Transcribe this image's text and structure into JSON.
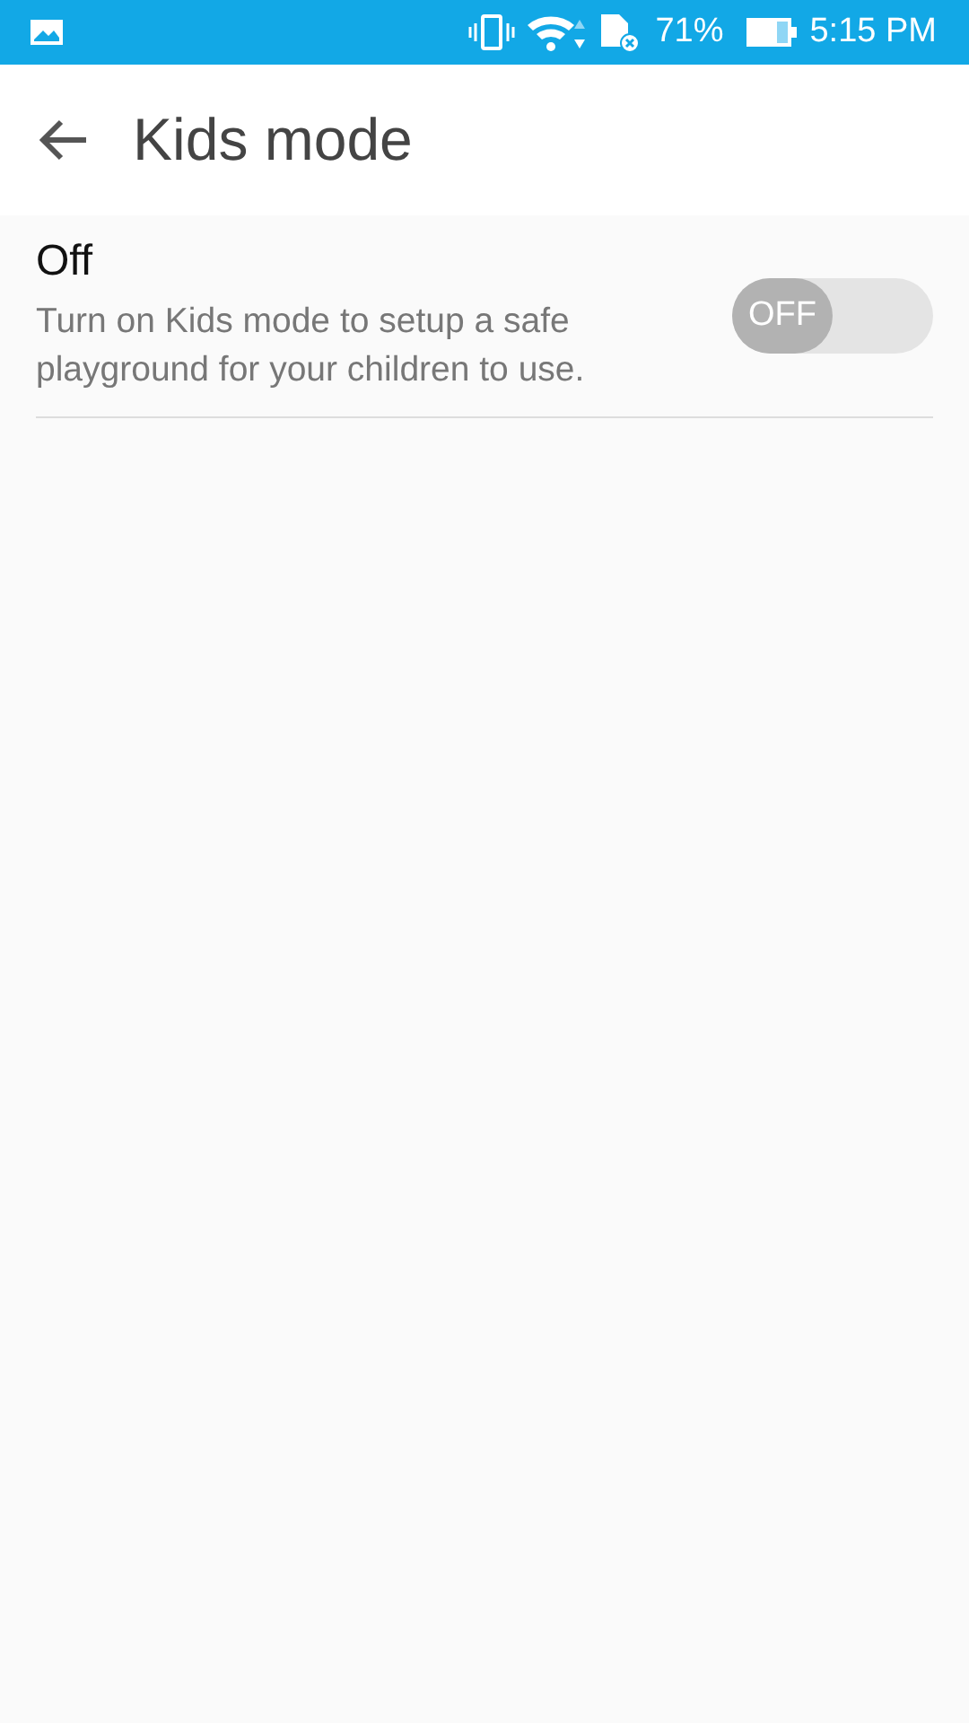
{
  "status_bar": {
    "battery": "71%",
    "time": "5:15 PM"
  },
  "app_bar": {
    "title": "Kids mode"
  },
  "setting": {
    "title": "Off",
    "description": "Turn on Kids mode to setup a safe playground for your children to use.",
    "switch_label": "OFF",
    "on": false
  }
}
